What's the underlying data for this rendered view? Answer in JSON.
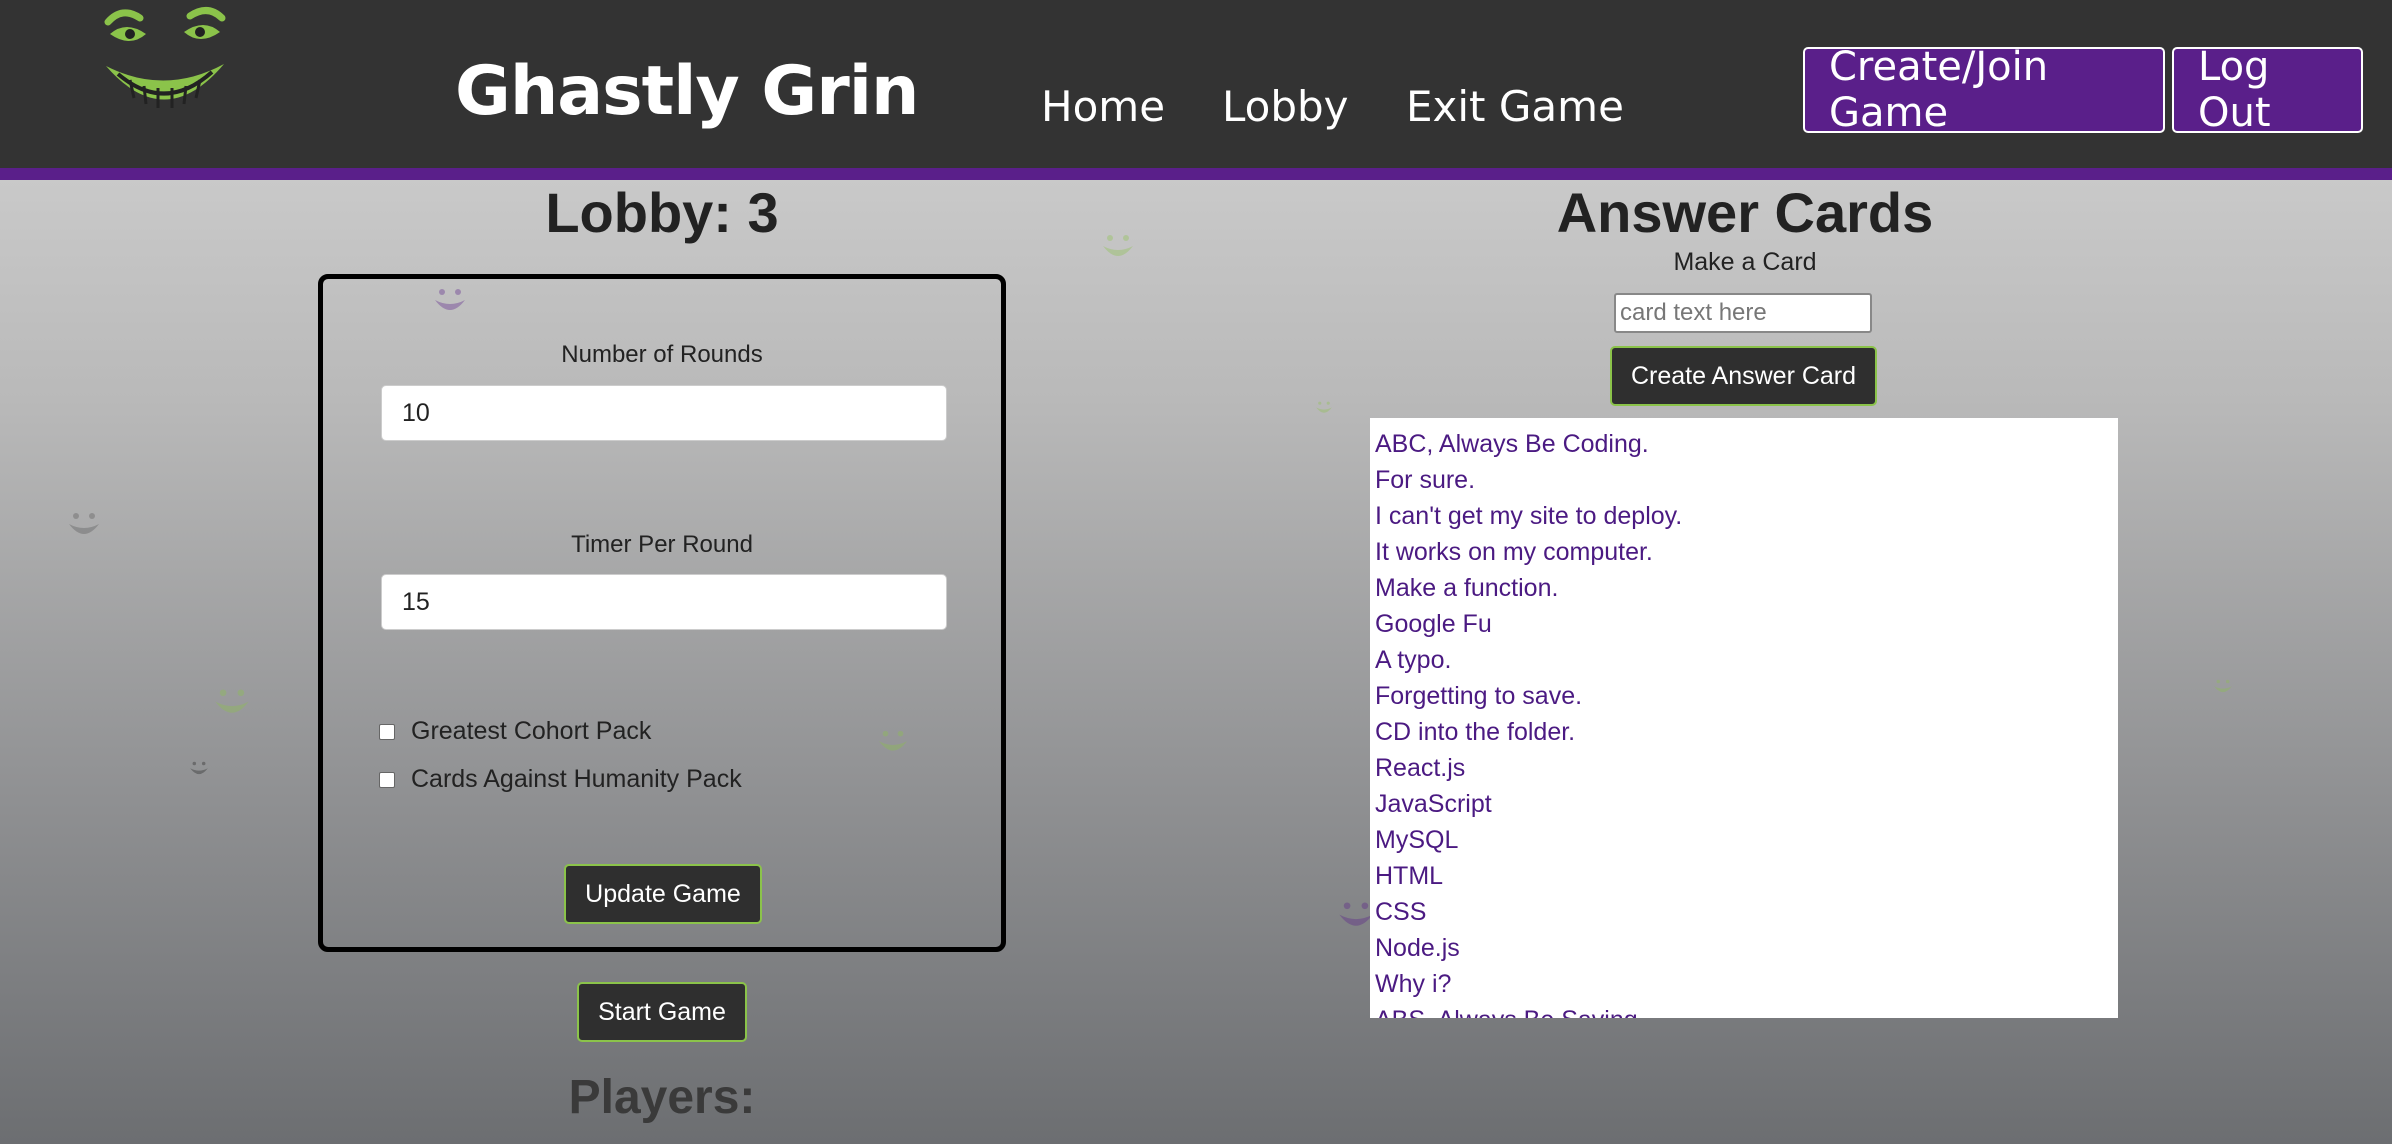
{
  "header": {
    "brand": "Ghastly Grin",
    "nav": [
      "Home",
      "Lobby",
      "Exit Game"
    ],
    "buttons": {
      "create_join": "Create/Join Game",
      "logout": "Log Out"
    },
    "logo_icon": "grinning-face-icon",
    "accent_color": "#5a1f8a",
    "logo_color": "#8bc34a"
  },
  "lobby": {
    "title": "Lobby: 3",
    "rounds_label": "Number of Rounds",
    "rounds_value": "10",
    "timer_label": "Timer Per Round",
    "timer_value": "15",
    "packs": [
      "Greatest Cohort Pack",
      "Cards Against Humanity Pack"
    ],
    "update_button": "Update Game",
    "start_button": "Start Game",
    "players_title": "Players:"
  },
  "answers": {
    "title": "Answer Cards",
    "make_label": "Make a Card",
    "input_placeholder": "card text here",
    "create_button": "Create Answer Card",
    "cards": [
      "ABC, Always Be Coding.",
      "For sure.",
      "I can't get my site to deploy.",
      "It works on my computer.",
      "Make a function.",
      "Google Fu",
      "A typo.",
      "Forgetting to save.",
      "CD into the folder.",
      "React.js",
      "JavaScript",
      "MySQL",
      "HTML",
      "CSS",
      "Node.js",
      "Why i?",
      "ABS, Always Be Saving."
    ]
  }
}
